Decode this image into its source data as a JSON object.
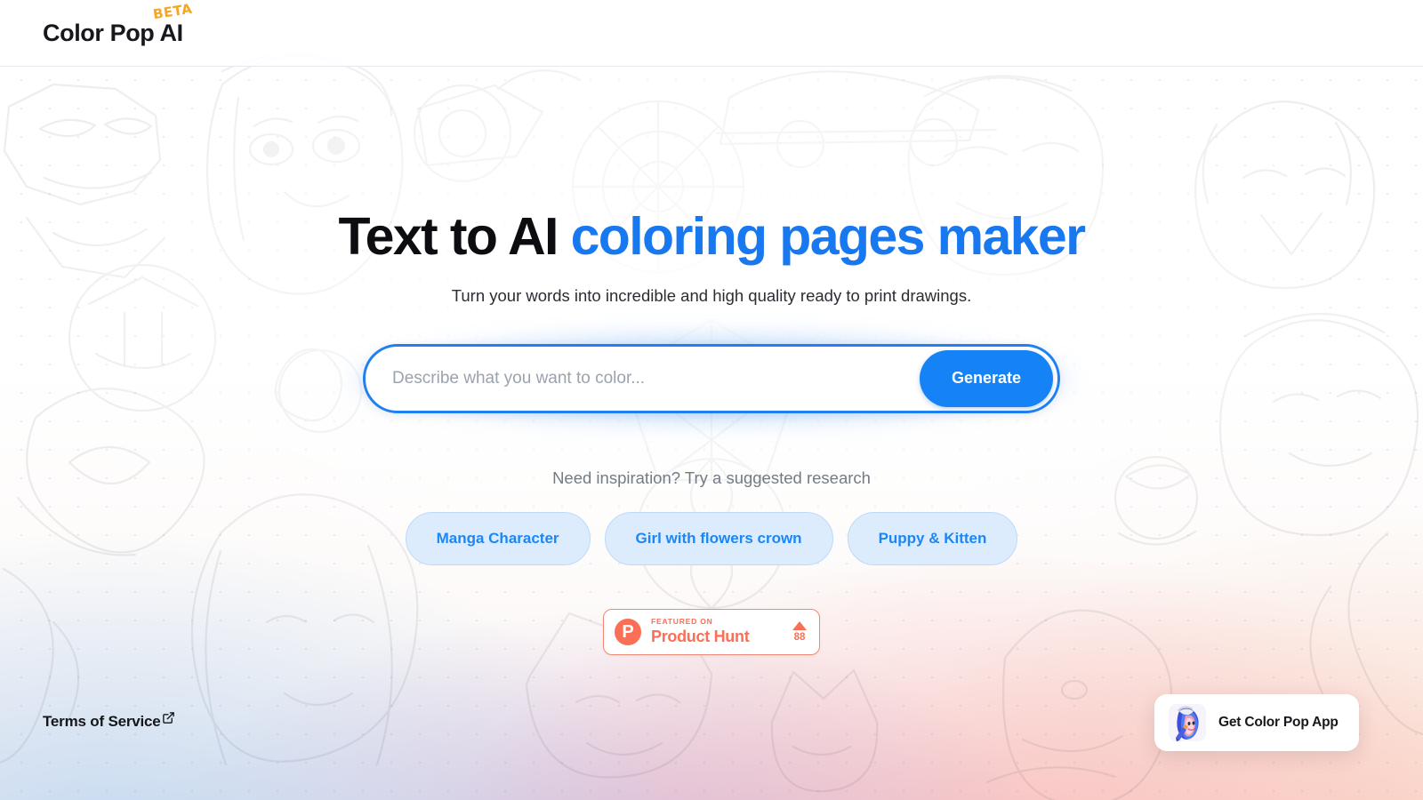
{
  "header": {
    "logo_text": "Color Pop AI",
    "beta_badge": "BETA"
  },
  "hero": {
    "headline_plain": "Text to AI",
    "headline_accent": "coloring pages maker",
    "subheadline": "Turn your words into incredible and high quality ready to print drawings."
  },
  "search": {
    "placeholder": "Describe what you want to color...",
    "value": "",
    "generate_label": "Generate"
  },
  "suggestions": {
    "label": "Need inspiration? Try a suggested research",
    "chips": [
      {
        "label": "Manga Character"
      },
      {
        "label": "Girl with flowers crown"
      },
      {
        "label": "Puppy & Kitten"
      }
    ]
  },
  "product_hunt": {
    "logo_letter": "P",
    "featured_on": "FEATURED ON",
    "name": "Product Hunt",
    "upvote_count": "88"
  },
  "footer": {
    "terms_label": "Terms of Service"
  },
  "app_card": {
    "label": "Get Color Pop App"
  },
  "colors": {
    "accent_blue": "#1878f0",
    "button_blue": "#1583f5",
    "chip_bg": "#ddecfd",
    "chip_text": "#1c86f5",
    "product_hunt_red": "#fa6f56",
    "beta_orange": "#f5a623",
    "text_dark": "#0c0d10"
  }
}
